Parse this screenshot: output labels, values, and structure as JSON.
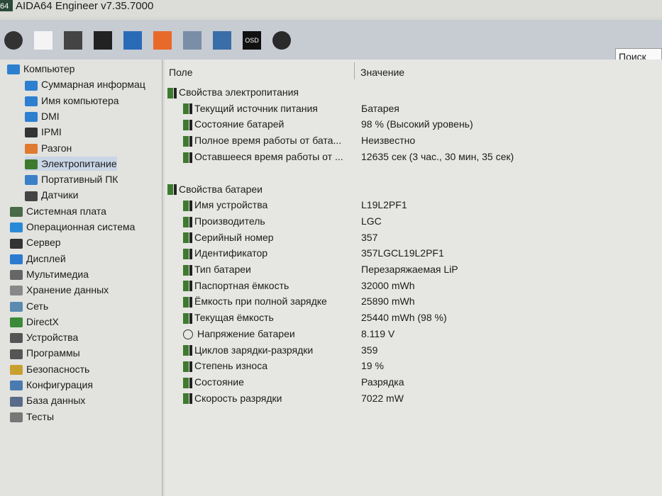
{
  "window": {
    "title": "AIDA64 Engineer v7.35.7000",
    "logo": "64"
  },
  "toolbar": {
    "icons": [
      "refresh-icon",
      "report-icon",
      "motherboard-icon",
      "memory-icon",
      "network-icon",
      "stability-flame-icon",
      "task-icon",
      "user-icon",
      "osd-icon",
      "sensor-gauge-icon"
    ],
    "osd_label": "OSD",
    "search_label": "Поиск"
  },
  "tree": [
    {
      "label": "Компьютер",
      "level": 0,
      "icon": "computer-icon"
    },
    {
      "label": "Суммарная информац",
      "level": 1,
      "icon": "computer-icon"
    },
    {
      "label": "Имя компьютера",
      "level": 1,
      "icon": "computer-icon"
    },
    {
      "label": "DMI",
      "level": 1,
      "icon": "computer-icon"
    },
    {
      "label": "IPMI",
      "level": 1,
      "icon": "server-icon"
    },
    {
      "label": "Разгон",
      "level": 1,
      "icon": "flame-icon"
    },
    {
      "label": "Электропитание",
      "level": 1,
      "icon": "battery-icon",
      "selected": true
    },
    {
      "label": "Портативный ПК",
      "level": 1,
      "icon": "laptop-icon"
    },
    {
      "label": "Датчики",
      "level": 1,
      "icon": "gauge-icon"
    },
    {
      "label": "Системная плата",
      "level": 0,
      "icon": "motherboard-icon"
    },
    {
      "label": "Операционная система",
      "level": 0,
      "icon": "windows-icon"
    },
    {
      "label": "Сервер",
      "level": 0,
      "icon": "server-icon"
    },
    {
      "label": "Дисплей",
      "level": 0,
      "icon": "display-icon"
    },
    {
      "label": "Мультимедиа",
      "level": 0,
      "icon": "speaker-icon"
    },
    {
      "label": "Хранение данных",
      "level": 0,
      "icon": "storage-icon"
    },
    {
      "label": "Сеть",
      "level": 0,
      "icon": "network-icon"
    },
    {
      "label": "DirectX",
      "level": 0,
      "icon": "xbox-icon"
    },
    {
      "label": "Устройства",
      "level": 0,
      "icon": "devices-icon"
    },
    {
      "label": "Программы",
      "level": 0,
      "icon": "programs-icon"
    },
    {
      "label": "Безопасность",
      "level": 0,
      "icon": "shield-icon"
    },
    {
      "label": "Конфигурация",
      "level": 0,
      "icon": "config-icon"
    },
    {
      "label": "База данных",
      "level": 0,
      "icon": "database-icon"
    },
    {
      "label": "Тесты",
      "level": 0,
      "icon": "tests-icon"
    }
  ],
  "table": {
    "col_field": "Поле",
    "col_value": "Значение",
    "rows": [
      {
        "field": "Свойства электропитания",
        "value": "",
        "group": true
      },
      {
        "field": "Текущий источник питания",
        "value": "Батарея"
      },
      {
        "field": "Состояние батарей",
        "value": "98 % (Высокий уровень)"
      },
      {
        "field": "Полное время работы от бата...",
        "value": "Неизвестно"
      },
      {
        "field": "Оставшееся время работы от ...",
        "value": "12635 сек (3 час., 30 мин, 35 сек)"
      },
      {
        "field": "",
        "value": "",
        "spacer": true
      },
      {
        "field": "Свойства батареи",
        "value": "",
        "group": true
      },
      {
        "field": "Имя устройства",
        "value": "L19L2PF1"
      },
      {
        "field": "Производитель",
        "value": "LGC"
      },
      {
        "field": "Серийный номер",
        "value": "357"
      },
      {
        "field": "Идентификатор",
        "value": "357LGCL19L2PF1"
      },
      {
        "field": "Тип батареи",
        "value": "Перезаряжаемая LiP"
      },
      {
        "field": "Паспортная ёмкость",
        "value": "32000 mWh"
      },
      {
        "field": "Ёмкость при полной зарядке",
        "value": "25890 mWh"
      },
      {
        "field": "Текущая ёмкость",
        "value": "25440 mWh  (98 %)"
      },
      {
        "field": "Напряжение батареи",
        "value": "8.119 V",
        "voltage": true
      },
      {
        "field": "Циклов зарядки-разрядки",
        "value": "359"
      },
      {
        "field": "Степень износа",
        "value": "19 %"
      },
      {
        "field": "Состояние",
        "value": "Разрядка"
      },
      {
        "field": "Скорость разрядки",
        "value": "7022 mW"
      }
    ]
  }
}
